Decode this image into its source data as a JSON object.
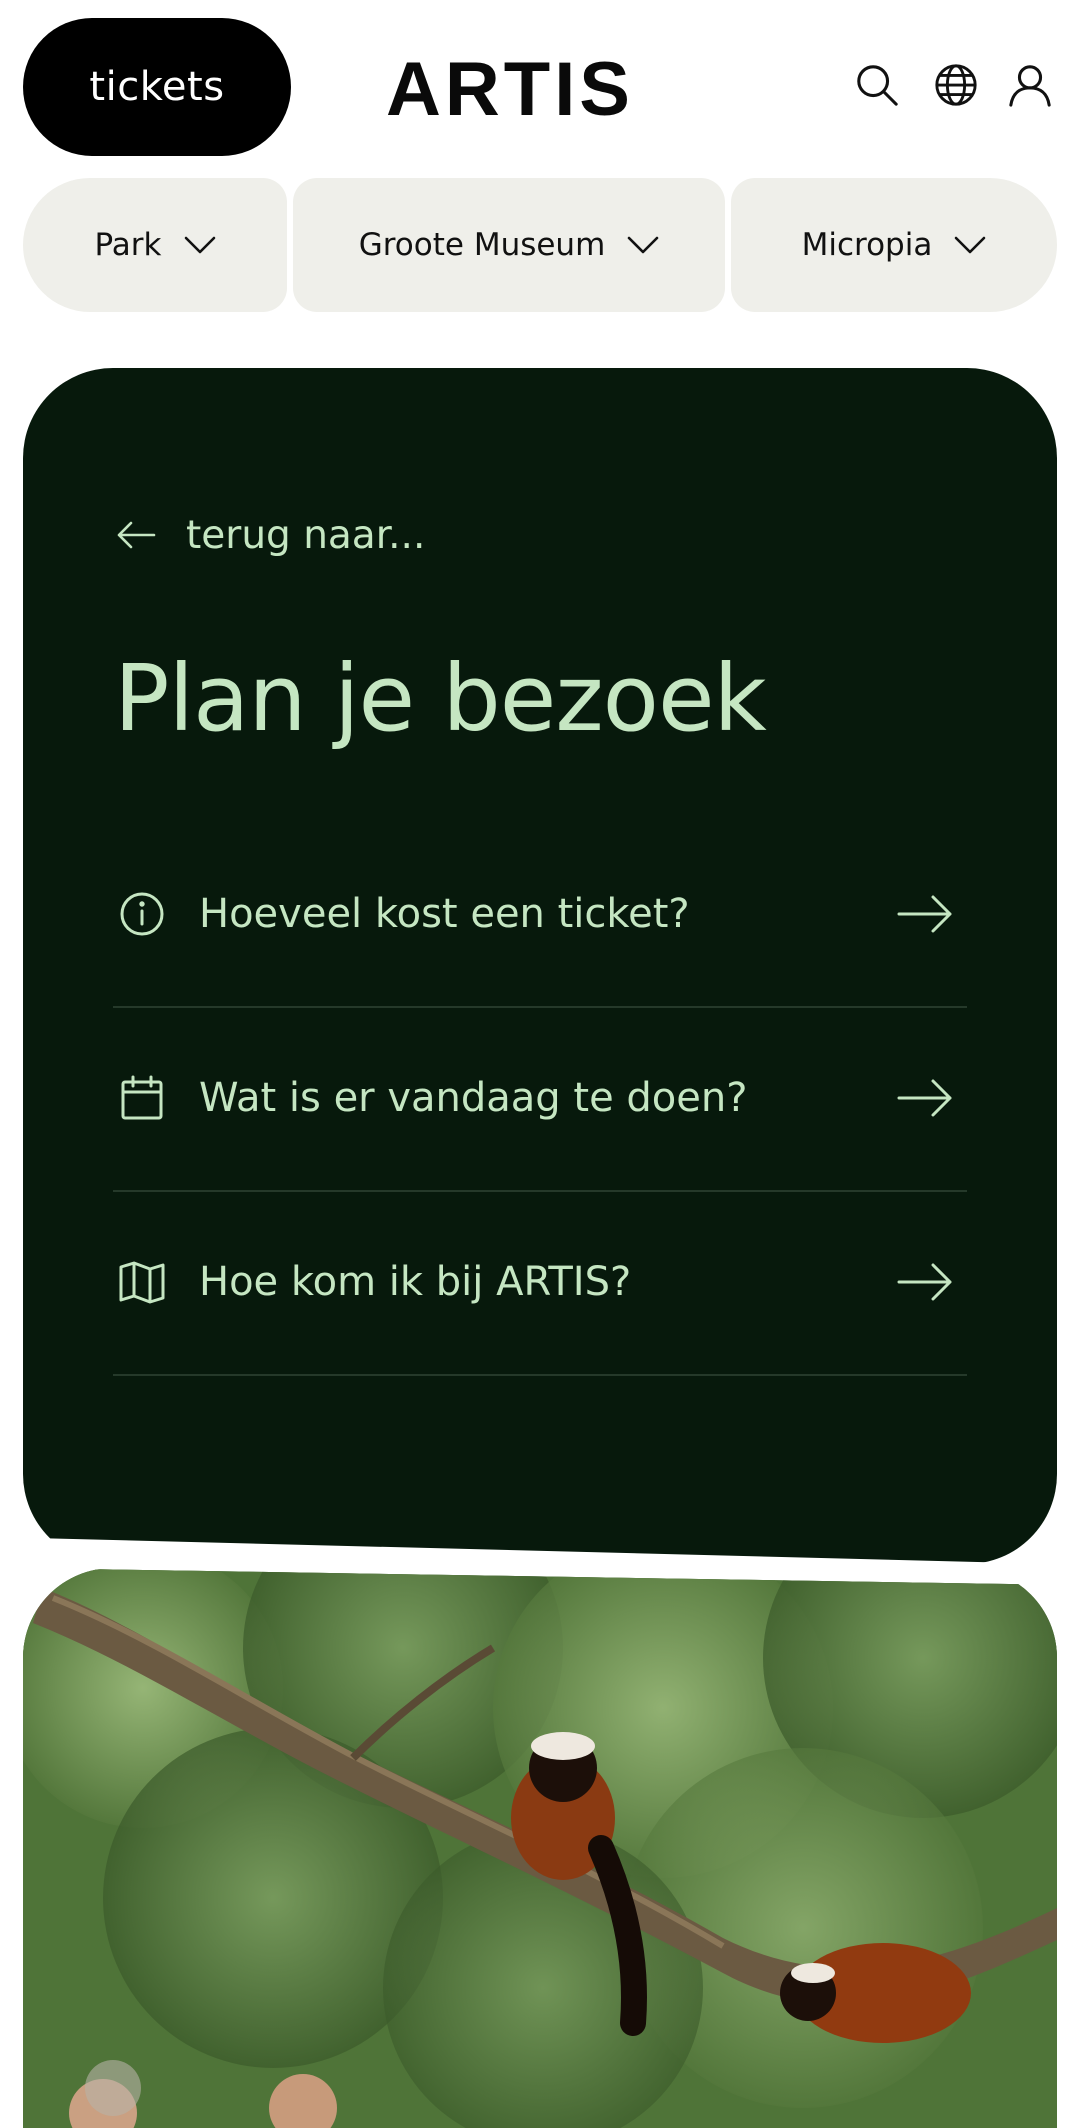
{
  "header": {
    "tickets_label": "tickets",
    "logo_text": "ARTIS",
    "icons": [
      "search-icon",
      "globe-icon",
      "user-icon"
    ]
  },
  "locations": [
    {
      "label": "Park"
    },
    {
      "label": "Groote Museum"
    },
    {
      "label": "Micropia"
    }
  ],
  "plan": {
    "back_label": "terug naar...",
    "title": "Plan je bezoek",
    "items": [
      {
        "icon": "info-icon",
        "label": "Hoeveel kost een ticket?"
      },
      {
        "icon": "calendar-icon",
        "label": "Wat is er vandaag te doen?"
      },
      {
        "icon": "map-icon",
        "label": "Hoe kom ik bij ARTIS?"
      }
    ]
  },
  "colors": {
    "card_bg": "#07190c",
    "card_text": "#c5e6c2",
    "pill_bg": "#efefea",
    "tickets_bg": "#000000"
  },
  "hero": {
    "image": "red-ruffed-lemurs-on-branch-photo"
  }
}
